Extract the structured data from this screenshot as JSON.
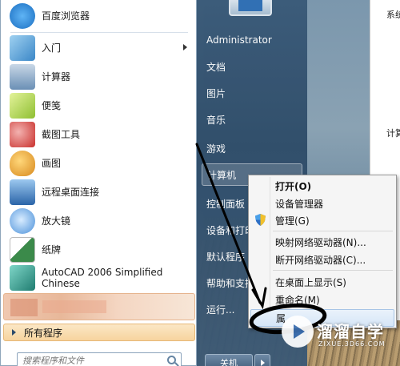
{
  "background_window": {
    "text1": "系统",
    "text2": "计算"
  },
  "programs": [
    {
      "label": "百度浏览器",
      "icon": "baidu-browser-icon",
      "color": "#2a8de0"
    },
    {
      "label": "入门",
      "icon": "getting-started-icon",
      "color": "#56a0d3",
      "has_submenu": true
    },
    {
      "label": "计算器",
      "icon": "calculator-icon",
      "color": "#6a8fb5"
    },
    {
      "label": "便笺",
      "icon": "sticky-notes-icon",
      "color": "#a8cf4a"
    },
    {
      "label": "截图工具",
      "icon": "snipping-tool-icon",
      "color": "#d9534f"
    },
    {
      "label": "画图",
      "icon": "paint-icon",
      "color": "#e7a23a"
    },
    {
      "label": "远程桌面连接",
      "icon": "remote-desktop-icon",
      "color": "#3d7fc4"
    },
    {
      "label": "放大镜",
      "icon": "magnifier-icon",
      "color": "#4a90d9"
    },
    {
      "label": "纸牌",
      "icon": "solitaire-icon",
      "color": "#3b8a4a"
    },
    {
      "label": "AutoCAD 2006 Simplified\nChinese",
      "icon": "autocad-icon",
      "color": "#2b9a8c"
    }
  ],
  "all_programs": "所有程序",
  "search": {
    "placeholder": "搜索程序和文件"
  },
  "right_items": [
    {
      "label": "Administrator"
    },
    {
      "label": "文档"
    },
    {
      "label": "图片"
    },
    {
      "label": "音乐"
    },
    {
      "label": "游戏"
    },
    {
      "label": "计算机",
      "highlighted": true
    },
    {
      "label": "控制面板"
    },
    {
      "label": "设备和打印"
    },
    {
      "label": "默认程序"
    },
    {
      "label": "帮助和支持"
    },
    {
      "label": "运行..."
    }
  ],
  "shutdown": "关机",
  "context_menu": [
    {
      "label": "打开(O)",
      "bold": true
    },
    {
      "label": "设备管理器"
    },
    {
      "label": "管理(G)",
      "icon": "uac-shield-icon"
    },
    {
      "label": "映射网络驱动器(N)..."
    },
    {
      "label": "断开网络驱动器(C)..."
    },
    {
      "label": "在桌面上显示(S)"
    },
    {
      "label": "重命名(M)"
    },
    {
      "label": "属",
      "highlighted": true
    }
  ],
  "watermark": {
    "name": "溜溜自学",
    "url": "ZIXUE.3D66.COM"
  }
}
